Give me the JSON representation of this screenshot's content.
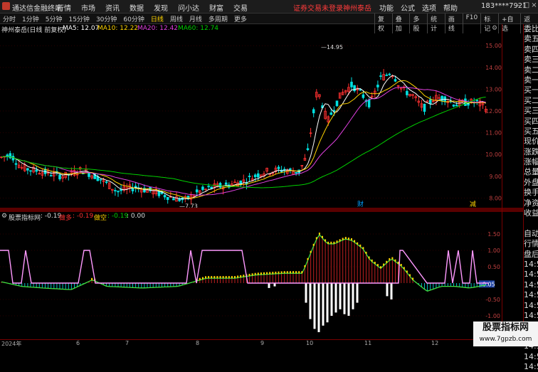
{
  "app": {
    "name": "通达信金融终端",
    "menu": [
      "行情",
      "市场",
      "资讯",
      "数据",
      "发现",
      "问小达",
      "财富",
      "交易"
    ],
    "warning": "证券交易未登录",
    "stock_name": "神州泰岳",
    "right_menu": [
      "功能",
      "公式",
      "选项",
      "帮助"
    ],
    "user": "183****7921",
    "window_buttons": [
      "minimize-icon",
      "restore-icon",
      "close-icon"
    ]
  },
  "toolbar": {
    "periods": [
      "分时",
      "1分钟",
      "5分钟",
      "15分钟",
      "30分钟",
      "60分钟",
      "日线",
      "周线",
      "月线",
      "多周期",
      "更多"
    ],
    "active": "日线",
    "buttons": [
      "复权",
      "叠加",
      "多股",
      "统计",
      "画线",
      "F10",
      "标记",
      "+自选",
      "返回"
    ]
  },
  "main": {
    "title": "神州泰岳(日线 前复权)",
    "ma": [
      {
        "label": "MA5: 12.07",
        "color": "#ffffff"
      },
      {
        "label": "MA10: 12.22",
        "color": "#ffd400"
      },
      {
        "label": "MA20: 12.42",
        "color": "#e040e0"
      },
      {
        "label": "MA60: 12.74",
        "color": "#00d000"
      }
    ],
    "y_axis": [
      "15.00",
      "14.00",
      "13.00",
      "12.00",
      "11.00",
      "10.00",
      "9.00",
      "8.00"
    ],
    "high_label": "14.95",
    "low_label": "7.73",
    "markers": [
      "财",
      "减"
    ],
    "colors": {
      "up": "#ff3030",
      "down": "#00e0e0"
    }
  },
  "indicator": {
    "name": "股票指标网",
    "value": ": -0.19",
    "short_label": "做多",
    "short_value": ": -0.19",
    "empty_label": "做空",
    "empty_value": ": -0.19",
    "empty_extra": ": 0.00",
    "y_axis": [
      "1.50",
      "1.00",
      "0.50",
      "-0.50",
      "-1.00"
    ],
    "current": "-0.05"
  },
  "dates": [
    "2024年",
    "6",
    "7",
    "8",
    "9",
    "10",
    "11",
    "12"
  ],
  "right_panel": [
    "委比",
    "卖五",
    "卖四",
    "卖三",
    "卖二",
    "卖一",
    "买一",
    "买二",
    "买三",
    "买四",
    "买五",
    "现价",
    "涨跌",
    "涨幅",
    "总量",
    "外盘",
    "换手",
    "净资",
    "收益",
    "",
    "自动",
    "行情",
    "盘后",
    "14:56",
    "14:56",
    "14:56",
    "14:56",
    "14:56",
    "14:56",
    "14:56",
    "14:56",
    "14:56",
    "14:56",
    "14:56"
  ],
  "watermark": {
    "line1": "股票指标网",
    "line2": "www.7gpzb.com"
  }
}
